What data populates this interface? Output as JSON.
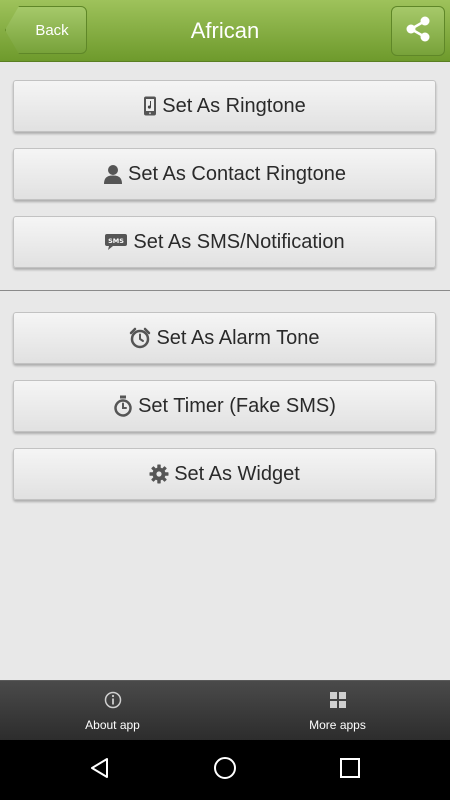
{
  "header": {
    "back_label": "Back",
    "title": "African",
    "share_icon": "share-icon"
  },
  "actions_group1": [
    {
      "label": "Set As Ringtone",
      "icon": "phone-music-icon"
    },
    {
      "label": "Set As Contact Ringtone",
      "icon": "contact-person-icon"
    },
    {
      "label": "Set As SMS/Notification",
      "icon": "sms-bubble-icon",
      "icon_text": "SMS"
    }
  ],
  "actions_group2": [
    {
      "label": "Set As Alarm Tone",
      "icon": "alarm-clock-icon"
    },
    {
      "label": "Set Timer (Fake SMS)",
      "icon": "stopwatch-icon"
    },
    {
      "label": "Set As Widget",
      "icon": "gear-icon"
    }
  ],
  "bottom_bar": {
    "about_label": "About app",
    "more_label": "More apps"
  },
  "colors": {
    "header_green": "#7ea63a",
    "background": "#e8e8e8",
    "bottom_bar": "#3a3a3a"
  }
}
